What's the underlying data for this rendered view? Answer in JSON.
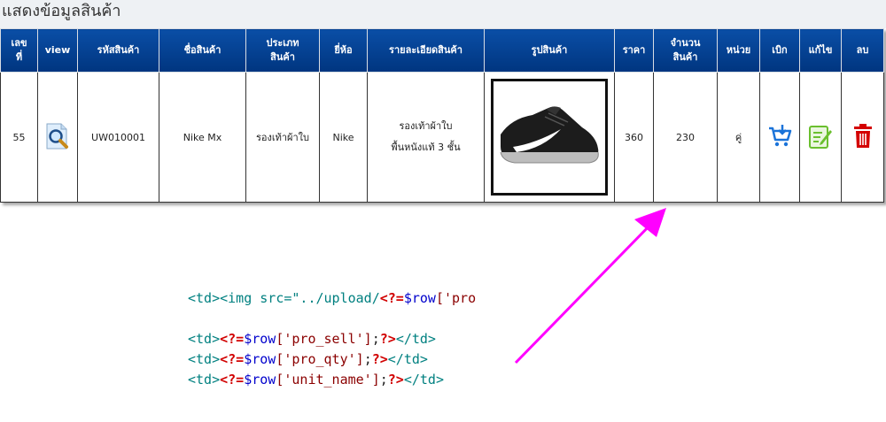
{
  "page": {
    "title": "แสดงข้อมูลสินค้า"
  },
  "table": {
    "headers": {
      "no_l1": "เลข",
      "no_l2": "ที่",
      "view": "view",
      "code": "รหัสสินค้า",
      "name": "ชื่อสินค้า",
      "type_l1": "ประเภท",
      "type_l2": "สินค้า",
      "brand": "ยี่ห้อ",
      "detail": "รายละเอียดสินค้า",
      "image": "รูปสินค้า",
      "price": "ราคา",
      "qty_l1": "จำนวน",
      "qty_l2": "สินค้า",
      "unit": "หน่วย",
      "withdraw": "เบิก",
      "edit": "แก้ไข",
      "delete": "ลบ"
    },
    "row": {
      "no": "55",
      "code": "UW010001",
      "name": "Nike Mx",
      "type": "รองเท้าผ้าใบ",
      "brand": "Nike",
      "detail_l1": "รองเท้าผ้าใบ",
      "detail_l2": "พื้นหนังแท้ 3 ชั้น",
      "price": "360",
      "qty": "230",
      "unit": "คู่"
    },
    "icons": {
      "view": "magnifier-icon",
      "withdraw": "cart-add-icon",
      "edit": "edit-note-icon",
      "delete": "trash-icon",
      "product_image": "black-nike-sneaker-icon"
    }
  },
  "code": {
    "line1": {
      "open": "<td><img src=\"../upload/",
      "php_open": "<?=",
      "var": "$row",
      "rest": "['pro"
    },
    "line2": {
      "open": "<td>",
      "php_open": "<?=",
      "var": "$row",
      "key": "['pro_sell']",
      "semi": ";",
      "php_close": "?>",
      "close": "</td>"
    },
    "line3": {
      "open": "<td>",
      "php_open": "<?=",
      "var": "$row",
      "key": "['pro_qty']",
      "semi": ";",
      "php_close": "?>",
      "close": "</td>"
    },
    "line4": {
      "open": "<td>",
      "php_open": "<?=",
      "var": "$row",
      "key": "['unit_name']",
      "semi": ";",
      "php_close": "?>",
      "close": "</td>"
    }
  },
  "colors": {
    "header_bg": "#0a4ea6",
    "arrow": "#ff00ff",
    "cart_icon": "#1a73d9",
    "edit_icon": "#6abf2e",
    "trash_icon": "#d40000"
  }
}
